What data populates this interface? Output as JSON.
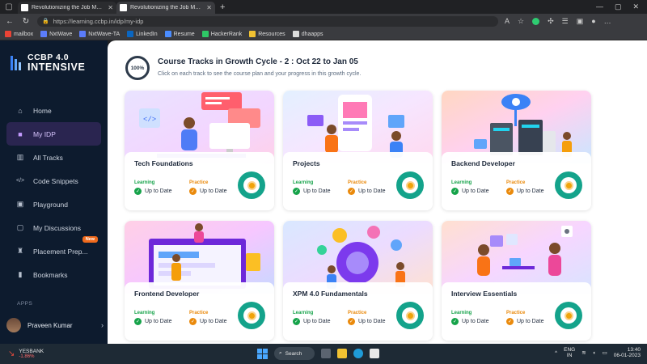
{
  "browser": {
    "tabs": [
      {
        "title": "Revolutionizing the Job Market |",
        "active": false
      },
      {
        "title": "Revolutionizing the Job Market |",
        "active": true
      }
    ],
    "url": "https://learning.ccbp.in/idp/my-idp",
    "bookmarks": [
      {
        "label": "mailbox",
        "color": "#ea4335"
      },
      {
        "label": "NxtWave",
        "color": "#5b7cfa"
      },
      {
        "label": "NxtWave-TA",
        "color": "#5b7cfa"
      },
      {
        "label": "LinkedIn",
        "color": "#0a66c2"
      },
      {
        "label": "Resume",
        "color": "#4a8cff"
      },
      {
        "label": "HackerRank",
        "color": "#2ec866"
      },
      {
        "label": "Resources",
        "color": "#f1c232"
      },
      {
        "label": "dhaapps",
        "color": "#dddddd"
      }
    ]
  },
  "sidebar": {
    "logo_line1": "CCBP 4.0",
    "logo_line2": "INTENSIVE",
    "items": [
      {
        "label": "Home",
        "icon": "home-icon",
        "glyph": "⌂"
      },
      {
        "label": "My IDP",
        "icon": "idp-icon",
        "glyph": "■"
      },
      {
        "label": "All Tracks",
        "icon": "book-icon",
        "glyph": "▥"
      },
      {
        "label": "Code Snippets",
        "icon": "code-icon",
        "glyph": "</>"
      },
      {
        "label": "Playground",
        "icon": "terminal-icon",
        "glyph": "▣"
      },
      {
        "label": "My Discussions",
        "icon": "chat-icon",
        "glyph": "▢"
      },
      {
        "label": "Placement Prep...",
        "icon": "placement-icon",
        "glyph": "♜"
      },
      {
        "label": "Bookmarks",
        "icon": "bookmark-icon",
        "glyph": "▮"
      }
    ],
    "new_badge": "New",
    "apps_label": "APPS",
    "user_name": "Praveen Kumar"
  },
  "header": {
    "progress": "100%",
    "title": "Course Tracks in Growth Cycle - 2 : Oct 22 to Jan 05",
    "subtitle": "Click on each track to see the course plan and your progress in this growth cycle."
  },
  "tracks": [
    {
      "name": "Tech Foundations",
      "learning_label": "Learning",
      "learning_status": "Up to Date",
      "practice_label": "Practice",
      "practice_status": "Up to Date"
    },
    {
      "name": "Projects",
      "learning_label": "Learning",
      "learning_status": "Up to Date",
      "practice_label": "Practice",
      "practice_status": "Up to Date"
    },
    {
      "name": "Backend Developer",
      "learning_label": "Learning",
      "learning_status": "Up to Date",
      "practice_label": "Practice",
      "practice_status": "Up to Date"
    },
    {
      "name": "Frontend Developer",
      "learning_label": "Learning",
      "learning_status": "Up to Date",
      "practice_label": "Practice",
      "practice_status": "Up to Date"
    },
    {
      "name": "XPM 4.0 Fundamentals",
      "learning_label": "Learning",
      "learning_status": "Up to Date",
      "practice_label": "Practice",
      "practice_status": "Up to Date"
    },
    {
      "name": "Interview Essentials",
      "learning_label": "Learning",
      "learning_status": "Up to Date",
      "practice_label": "Practice",
      "practice_status": "Up to Date"
    }
  ],
  "taskbar": {
    "stock_name": "YESBANK",
    "stock_change": "-1.86%",
    "search_label": "Search",
    "lang_line1": "ENG",
    "lang_line2": "IN",
    "time": "13:40",
    "date": "06-01-2023"
  }
}
